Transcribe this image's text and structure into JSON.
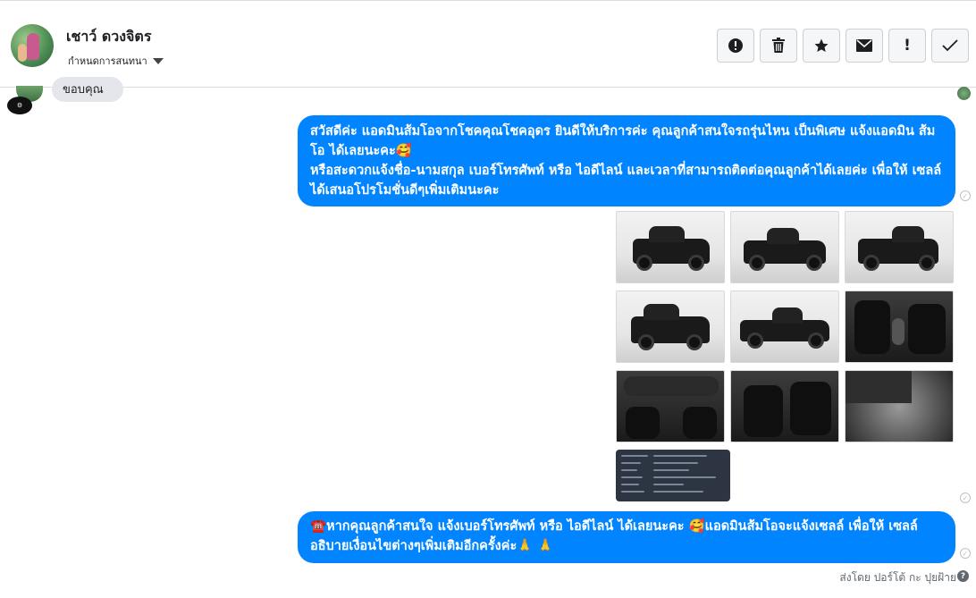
{
  "header": {
    "contact_name": "เชาว์ ดวงจิตร",
    "status_label": "กำหนดการสนทนา",
    "actions": [
      {
        "icon": "alert-circle-icon",
        "glyph": "!"
      },
      {
        "icon": "trash-icon",
        "glyph": "🗑"
      },
      {
        "icon": "star-icon",
        "glyph": "★"
      },
      {
        "icon": "envelope-icon",
        "glyph": "✉"
      },
      {
        "icon": "exclamation-icon",
        "glyph": "!"
      },
      {
        "icon": "checkmark-icon",
        "glyph": "✓"
      }
    ]
  },
  "messages": {
    "partial_incoming": "ขอบคุณ",
    "outgoing_1": "สวัสดีค่ะ แอดมินส้มโอจากโชคคุณโชคอุดร ยินดีให้บริการค่ะ   คุณลูกค้าสนใจรถรุ่นไหน เป็นพิเศษ แจ้งแอดมิน ส้มโอ ได้เลยนะคะ🥰\nหรือสะดวกแจ้งชื่อ-นามสกุล เบอร์โทรศัพท์ หรือ ไอดีไลน์ และเวลาที่สามารถติดต่อคุณลูกค้าได้เลยค่ะ เพื่อให้ เซลล์ได้เสนอโปรโมชั่นดีๆเพิ่มเติมนะคะ",
    "outgoing_2": "☎️หากคุณลูกค้าสนใจ แจ้งเบอร์โทรศัพท์ หรือ ไอดีไลน์  ได้เลยนะคะ 🥰แอดมินส้มโอจะแจ้งเซลล์     เพื่อให้ เซลล์อธิบายเงื่อนไขต่างๆเพิ่มเติมอีกครั้งค่ะ🙏 🙏"
  },
  "footer": {
    "sent_by": "ส่งโดย ปอร์โต้ กะ ปุยฝ้าย",
    "help_glyph": "?"
  },
  "colors": {
    "bubble_outgoing": "#0084ff",
    "bubble_incoming": "#e4e6eb"
  }
}
